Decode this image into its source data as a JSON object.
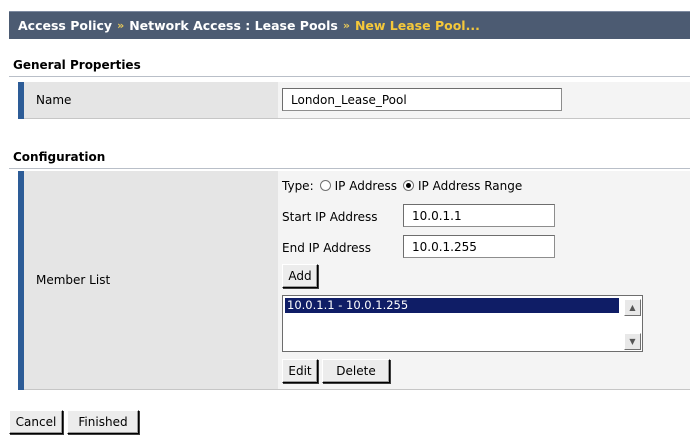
{
  "breadcrumb": {
    "item1": "Access Policy",
    "separator": "»",
    "item2": "Network Access : Lease Pools",
    "current": "New Lease Pool..."
  },
  "general": {
    "heading": "General Properties",
    "name_label": "Name",
    "name_value": "London_Lease_Pool"
  },
  "configuration": {
    "heading": "Configuration",
    "member_list_label": "Member List",
    "type_label": "Type:",
    "type_option_ip": "IP Address",
    "type_option_range": "IP Address Range",
    "type_selected": "IP Address Range",
    "start_ip_label": "Start IP Address",
    "start_ip_value": "10.0.1.1",
    "end_ip_label": "End IP Address",
    "end_ip_value": "10.0.1.255",
    "add_label": "Add",
    "members": [
      "10.0.1.1 - 10.0.1.255"
    ],
    "edit_label": "Edit",
    "delete_label": "Delete"
  },
  "footer": {
    "cancel_label": "Cancel",
    "finished_label": "Finished"
  },
  "colors": {
    "titlebar_bg": "#4c5b72",
    "breadcrumb_current": "#f5c83a",
    "row_accent": "#2d5c97",
    "selection": "#0f1d66"
  },
  "icons": {
    "scroll_up": "arrow-up-icon",
    "scroll_down": "arrow-down-icon"
  }
}
